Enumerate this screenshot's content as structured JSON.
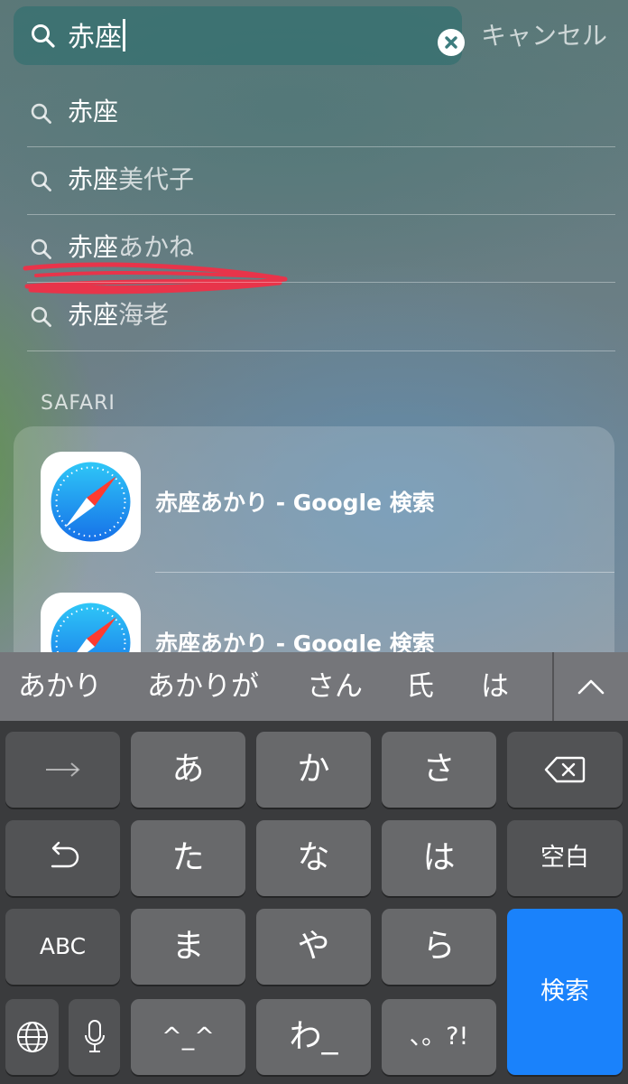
{
  "search": {
    "query": "赤座",
    "cancel_label": "キャンセル"
  },
  "suggestions": [
    {
      "match": "赤座",
      "rest": ""
    },
    {
      "match": "赤座",
      "rest": "美代子"
    },
    {
      "match": "赤座",
      "rest": "あかね"
    },
    {
      "match": "赤座",
      "rest": "海老"
    }
  ],
  "safari": {
    "section_label": "SAFARI",
    "results": [
      {
        "title": "赤座あかり - Google 検索",
        "icon": "safari-compass-icon"
      },
      {
        "title": "赤座あかり - Google 検索",
        "icon": "safari-compass-icon"
      }
    ]
  },
  "keyboard": {
    "candidates": [
      "あかり",
      "あかりが",
      "さん",
      "氏",
      "は"
    ],
    "keys": {
      "next": "→",
      "a": "あ",
      "ka": "か",
      "sa": "さ",
      "delete": "delete-icon",
      "undo": "undo-icon",
      "ta": "た",
      "na": "な",
      "ha": "は",
      "space": "空白",
      "abc": "ABC",
      "ma": "ま",
      "ya": "や",
      "ra": "ら",
      "search": "検索",
      "globe": "globe-icon",
      "mic": "microphone-icon",
      "emoji": "^_^",
      "wa": "わ_",
      "punct": "、。?!"
    },
    "accent_color": "#1a82fb"
  }
}
